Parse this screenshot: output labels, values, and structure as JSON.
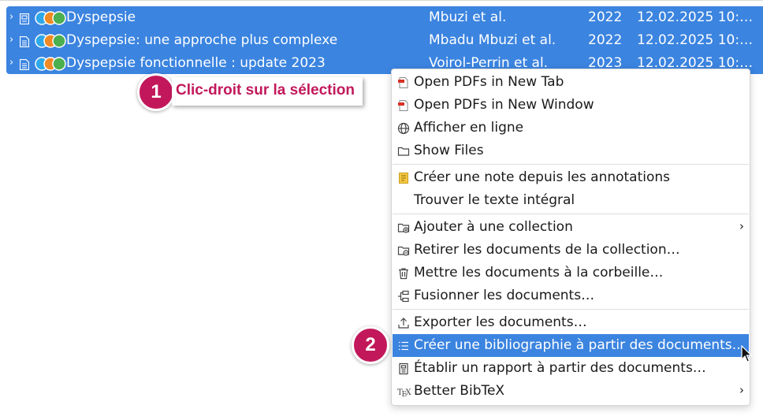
{
  "items": [
    {
      "title": "Dyspepsie",
      "creator": "Mbuzi et al.",
      "year": "2022",
      "date_modified": "12.02.2025 10:…",
      "item_type_icon": "book-section-icon"
    },
    {
      "title": "Dyspepsie: une approche plus complexe",
      "creator": "Mbadu Mbuzi et al.",
      "year": "2022",
      "date_modified": "12.02.2025 10:…",
      "item_type_icon": "document-icon"
    },
    {
      "title": "Dyspepsie fonctionnelle : update 2023",
      "creator": "Voirol-Perrin et al.",
      "year": "2023",
      "date_modified": "12.02.2025 10:…",
      "item_type_icon": "document-icon"
    }
  ],
  "tag_colors": [
    "#2ea8e8",
    "#f08a24",
    "#4caf50"
  ],
  "context_menu": {
    "open_pdfs_new_tab": "Open PDFs in New Tab",
    "open_pdfs_new_window": "Open PDFs in New Window",
    "view_online": "Afficher en ligne",
    "show_files": "Show Files",
    "create_note": "Créer une note depuis les annotations",
    "find_full_text": "Trouver le texte intégral",
    "add_to_collection": "Ajouter à une collection",
    "remove_from_collection": "Retirer les documents de la collection…",
    "move_to_trash": "Mettre les documents à la corbeille…",
    "merge_items": "Fusionner les documents…",
    "export_items": "Exporter les documents…",
    "create_bibliography": "Créer une bibliographie à partir des documents…",
    "generate_report": "Établir un rapport à partir des documents…",
    "better_bibtex": "Better BibTeX"
  },
  "annotations": {
    "step1_number": "1",
    "step1_text": "Clic-droit sur la sélection",
    "step2_number": "2"
  },
  "colors": {
    "selection": "#3b84e0",
    "accent": "#c2185b"
  }
}
